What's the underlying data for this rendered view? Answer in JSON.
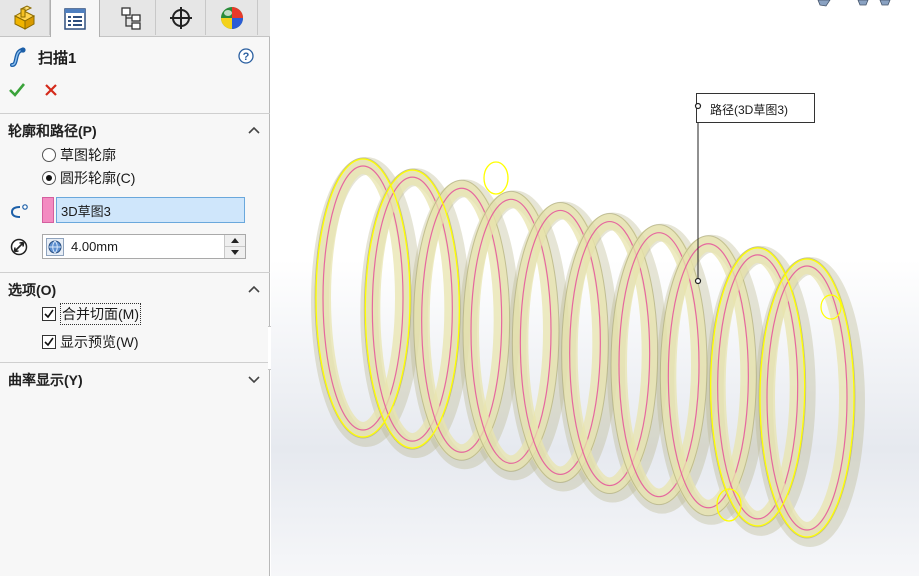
{
  "property_manager": {
    "tabs": [
      {
        "icon": "feature-manager-icon"
      },
      {
        "icon": "property-manager-icon",
        "active": true
      },
      {
        "icon": "configuration-manager-icon"
      },
      {
        "icon": "dimxpert-manager-icon"
      },
      {
        "icon": "display-manager-icon"
      }
    ],
    "feature_title": "扫描1",
    "profile_and_path": {
      "title": "轮廓和路径(P)",
      "radio_sketch_profile": "草图轮廓",
      "radio_circular_profile": "圆形轮廓(C)",
      "selected_radio": "circular",
      "path_value": "3D草图3",
      "path_color": "#f38bc1",
      "diameter_value": "4.00mm"
    },
    "options": {
      "title": "选项(O)",
      "merge_tangent_faces": "合并切面(M)",
      "merge_tangent_faces_checked": true,
      "show_preview": "显示预览(W)",
      "show_preview_checked": true
    },
    "curvature_display": {
      "title": "曲率显示(Y)"
    }
  },
  "viewport": {
    "callout_label": "路径(3D草图3)",
    "preview_color": "#e8e4ad",
    "path_color": "#e5529a",
    "highlight_color": "#ffff00"
  }
}
